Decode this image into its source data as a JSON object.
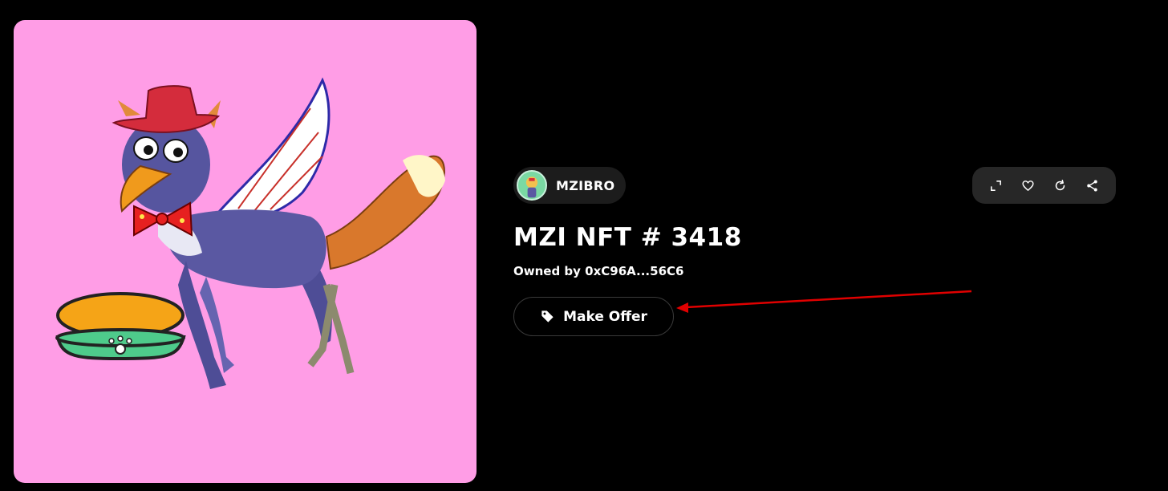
{
  "collection": {
    "name": "MZIBRO",
    "avatar_icon": "collection-avatar-icon"
  },
  "toolbar": {
    "icons": [
      "expand-icon",
      "heart-icon",
      "refresh-icon",
      "share-icon"
    ]
  },
  "nft": {
    "title": "MZI NFT # 3418",
    "owner_text": "Owned by 0xC96A...56C6",
    "background_color": "#ff9de6"
  },
  "actions": {
    "make_offer_label": "Make Offer",
    "make_offer_icon": "tag-icon"
  },
  "annotation": {
    "arrow_color": "#e00000"
  }
}
